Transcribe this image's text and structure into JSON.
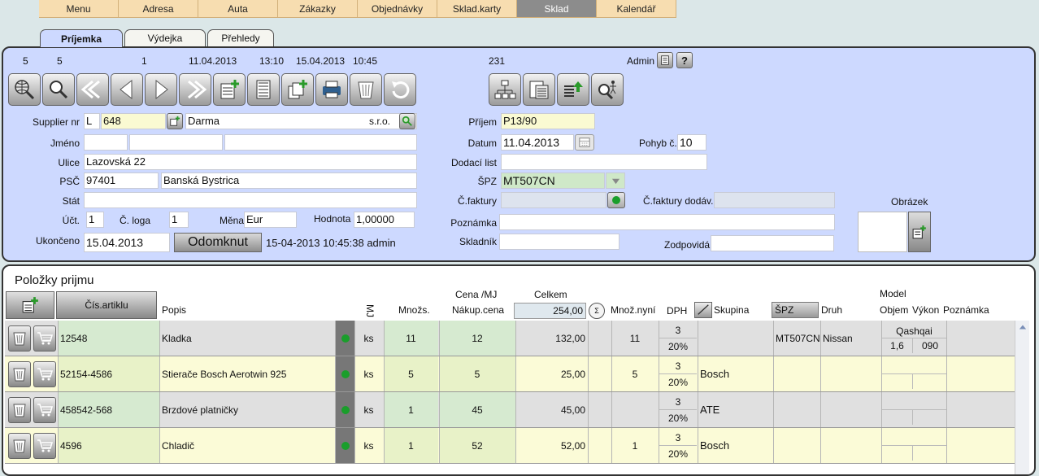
{
  "menu": {
    "items": [
      "Menu",
      "Adresa",
      "Auta",
      "Zákazky",
      "Objednávky",
      "Sklad.karty",
      "Sklad",
      "Kalendář"
    ],
    "active": "Sklad"
  },
  "tabs": [
    "Príjemka",
    "Výdejka",
    "Přehledy"
  ],
  "header": {
    "n1": "5",
    "n2": "5",
    "n3": "1",
    "date1": "11.04.2013",
    "time1": "13:10",
    "date2": "15.04.2013",
    "time2": "10:45",
    "num": "231",
    "user": "Admin"
  },
  "form": {
    "supplier_label": "Supplier nr",
    "supplier_type": "L",
    "supplier_nr": "648",
    "supplier_name": "Darma",
    "supplier_suffix": "s.r.o.",
    "jmeno_label": "Jméno",
    "ulice_label": "Ulice",
    "ulice": "Lazovská 22",
    "psc_label": "PSČ",
    "psc": "97401",
    "city": "Banská Bystrica",
    "stat_label": "Stát",
    "uct_label": "Účt.",
    "uct": "1",
    "cloga_label": "Č. loga",
    "cloga": "1",
    "mena_label": "Měna",
    "mena": "Eur",
    "hodnota_label": "Hodnota",
    "hodnota": "1,00000",
    "ukonceno_label": "Ukončeno",
    "ukonceno": "15.04.2013",
    "odomknut_label": "Odomknut",
    "odomknut_info": "15-04-2013 10:45:38 admin",
    "prijem_label": "Příjem",
    "prijem": "P13/90",
    "datum_label": "Datum",
    "datum": "11.04.2013",
    "pohyb_label": "Pohyb č.",
    "pohyb": "10",
    "dodaci_label": "Dodací list",
    "spz_label": "ŠPZ",
    "spz": "MT507CN",
    "cfaktury_label": "Č.faktury",
    "cfaktury_dod_label": "Č.faktury dodáv.",
    "poznamka_label": "Poznámka",
    "skladnik_label": "Skladník",
    "zodpovida_label": "Zodpovidá",
    "obrazek_label": "Obrázek"
  },
  "items_title": "Položky prijmu",
  "columns": {
    "cis": "Čís.artiklu",
    "popis": "Popis",
    "mj": "MJ",
    "mnozs": "Množs.",
    "cena_top": "Cena /MJ",
    "cena": "Nákup.cena",
    "celkem": "Celkem",
    "celkem_val": "254,00",
    "mnoz_nyni": "Množ.nyní",
    "dph": "DPH",
    "skupina": "Skupina",
    "spz": "ŠPZ",
    "druh": "Druh",
    "model": "Model",
    "objem": "Objem",
    "vykon": "Výkon",
    "poznamka": "Poznámka"
  },
  "rows": [
    {
      "cis": "12548",
      "popis": "Kladka",
      "mj": "ks",
      "mnozs": "11",
      "cena": "12",
      "celkem": "132,00",
      "mnoz_nyni": "11",
      "dph_code": "3",
      "dph_pct": "20%",
      "skupina": "",
      "spz": "MT507CN",
      "druh": "Nissan",
      "model": "Qashqai",
      "objem": "1,6",
      "vykon": "090"
    },
    {
      "cis": "52154-4586",
      "popis": "Stierače Bosch Aerotwin 925",
      "mj": "ks",
      "mnozs": "5",
      "cena": "5",
      "celkem": "25,00",
      "mnoz_nyni": "5",
      "dph_code": "3",
      "dph_pct": "20%",
      "skupina": "Bosch",
      "spz": "",
      "druh": "",
      "model": "",
      "objem": "",
      "vykon": ""
    },
    {
      "cis": "458542-568",
      "popis": "Brzdové platničky",
      "mj": "ks",
      "mnozs": "1",
      "cena": "45",
      "celkem": "45,00",
      "mnoz_nyni": "",
      "dph_code": "3",
      "dph_pct": "20%",
      "skupina": "ATE",
      "spz": "",
      "druh": "",
      "model": "",
      "objem": "",
      "vykon": ""
    },
    {
      "cis": "4596",
      "popis": "Chladič",
      "mj": "ks",
      "mnozs": "1",
      "cena": "52",
      "celkem": "52,00",
      "mnoz_nyni": "1",
      "dph_code": "3",
      "dph_pct": "20%",
      "skupina": "Bosch",
      "spz": "",
      "druh": "",
      "model": "",
      "objem": "",
      "vykon": ""
    }
  ],
  "toolbar_icons": [
    "globe-search-icon",
    "search-icon",
    "first-record-icon",
    "previous-record-icon",
    "next-record-icon",
    "last-record-icon",
    "new-record-icon",
    "document-icon",
    "add-records-icon",
    "print-icon",
    "delete-icon",
    "undo-icon",
    "tree-icon",
    "report-icon",
    "export-icon",
    "advanced-search-icon"
  ]
}
